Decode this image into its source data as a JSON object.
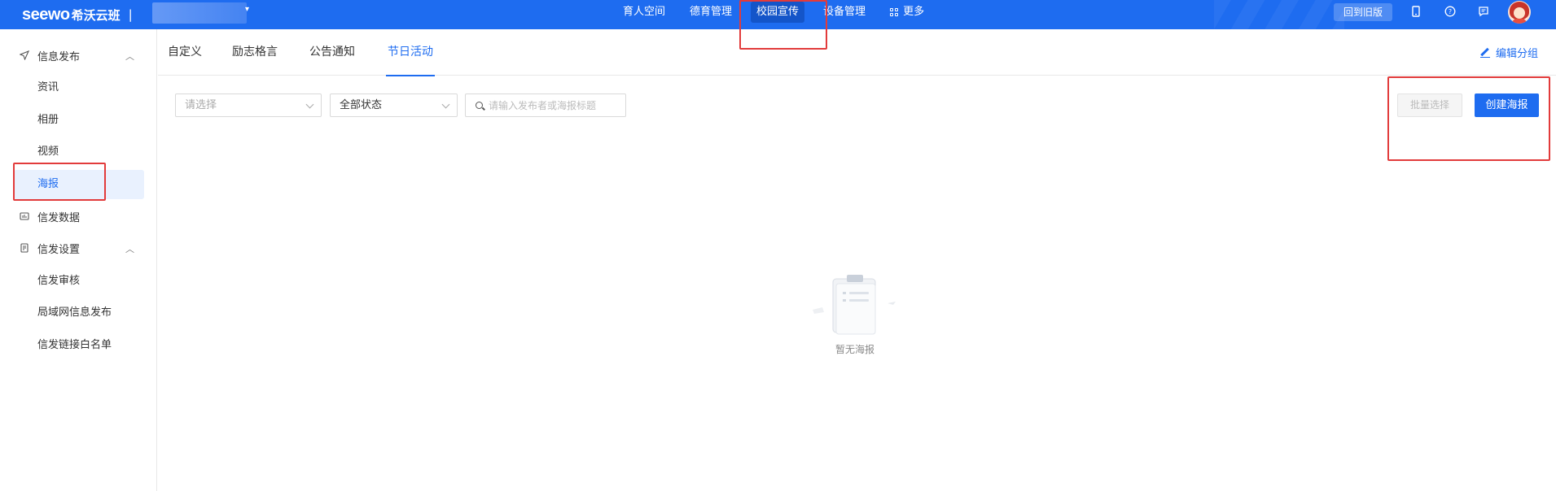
{
  "app": {
    "brand": "seewo",
    "brand_cn": "希沃云班",
    "divider": "|"
  },
  "topnav": {
    "items": [
      {
        "label": "育人空间"
      },
      {
        "label": "德育管理"
      },
      {
        "label": "校园宣传",
        "active": true
      },
      {
        "label": "设备管理"
      },
      {
        "label": "更多"
      }
    ],
    "back_old": "回到旧版",
    "icons": [
      "tablet-icon",
      "help-icon",
      "message-icon"
    ]
  },
  "sidebar": {
    "group1": {
      "label": "信息发布",
      "icon": "send-icon"
    },
    "group1_items": [
      {
        "label": "资讯"
      },
      {
        "label": "相册"
      },
      {
        "label": "视频"
      },
      {
        "label": "海报",
        "active": true
      }
    ],
    "group2": {
      "label": "信发数据",
      "icon": "data-icon"
    },
    "group3": {
      "label": "信发设置",
      "icon": "settings-doc-icon"
    },
    "group3_items": [
      {
        "label": "信发审核"
      },
      {
        "label": "局域网信息发布"
      },
      {
        "label": "信发链接白名单"
      }
    ]
  },
  "tabs": {
    "items": [
      {
        "label": "自定义"
      },
      {
        "label": "励志格言"
      },
      {
        "label": "公告通知"
      },
      {
        "label": "节日活动",
        "active": true
      }
    ],
    "edit_group": "编辑分组"
  },
  "filters": {
    "select1_placeholder": "请选择",
    "select2_value": "全部状态",
    "search_placeholder": "请输入发布者或海报标题"
  },
  "actions": {
    "batch_select": "批量选择",
    "create_poster": "创建海报"
  },
  "empty": {
    "text": "暂无海报"
  },
  "colors": {
    "primary": "#1e6cf0",
    "annotation": "#e23b3b"
  }
}
